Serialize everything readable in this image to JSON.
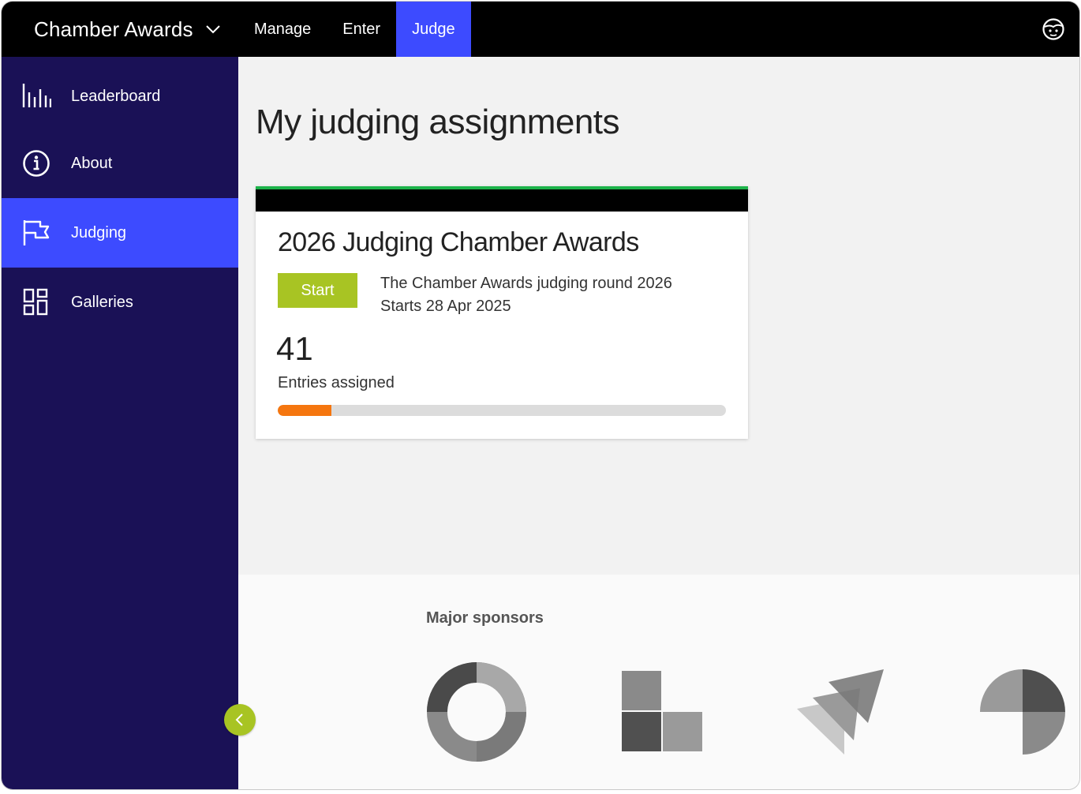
{
  "app": {
    "name": "Chamber Awards"
  },
  "topnav": {
    "items": [
      {
        "label": "Manage",
        "active": false
      },
      {
        "label": "Enter",
        "active": false
      },
      {
        "label": "Judge",
        "active": true
      }
    ],
    "user_icon": "user-face-icon"
  },
  "sidebar": {
    "items": [
      {
        "label": "Leaderboard",
        "icon": "bar-chart-icon",
        "active": false
      },
      {
        "label": "About",
        "icon": "info-icon",
        "active": false
      },
      {
        "label": "Judging",
        "icon": "flag-icon",
        "active": true
      },
      {
        "label": "Galleries",
        "icon": "dashboard-grid-icon",
        "active": false
      }
    ],
    "collapse_icon": "chevron-left-icon"
  },
  "main": {
    "title": "My judging assignments",
    "card": {
      "title": "2026 Judging Chamber Awards",
      "start_label": "Start",
      "description": "The Chamber Awards judging round 2026",
      "start_date": "Starts 28 Apr 2025",
      "count": "41",
      "count_label": "Entries assigned",
      "progress": 0.12
    }
  },
  "sponsors": {
    "title": "Major sponsors",
    "logos": [
      "ring-logo",
      "blocks-logo",
      "arrows-logo",
      "quarter-circle-logo"
    ]
  },
  "colors": {
    "topbar": "#000000",
    "sidebar": "#1a1156",
    "active": "#3d4bff",
    "start_button": "#a8c423",
    "progress_fill": "#f5760f",
    "card_accent": "#1db34a"
  }
}
